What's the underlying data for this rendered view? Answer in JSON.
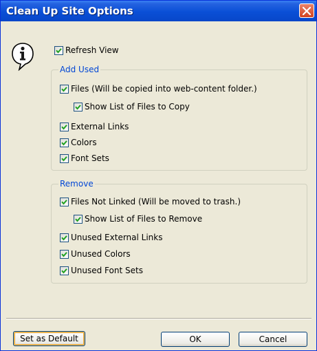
{
  "window": {
    "title": "Clean Up Site Options"
  },
  "options": {
    "refresh_view": {
      "label": "Refresh View",
      "checked": true
    }
  },
  "add_used": {
    "legend": "Add Used",
    "files": {
      "label": "Files (Will be copied into web-content folder.)",
      "checked": true
    },
    "show_files_to_copy": {
      "label": "Show List of Files to Copy",
      "checked": true
    },
    "external_links": {
      "label": "External Links",
      "checked": true
    },
    "colors": {
      "label": "Colors",
      "checked": true
    },
    "font_sets": {
      "label": "Font Sets",
      "checked": true
    }
  },
  "remove": {
    "legend": "Remove",
    "files_not_linked": {
      "label": "Files Not Linked (Will be moved to trash.)",
      "checked": true
    },
    "show_files_to_remove": {
      "label": "Show List of Files to Remove",
      "checked": true
    },
    "unused_external_links": {
      "label": "Unused External Links",
      "checked": true
    },
    "unused_colors": {
      "label": "Unused Colors",
      "checked": true
    },
    "unused_font_sets": {
      "label": "Unused Font Sets",
      "checked": true
    }
  },
  "buttons": {
    "set_default": "Set as Default",
    "ok": "OK",
    "cancel": "Cancel"
  },
  "icons": {
    "info": "info-icon",
    "close": "close-icon",
    "check": "checkmark-icon"
  },
  "colors": {
    "title_bar": "#0a4fd6",
    "close_button": "#d2421f",
    "dialog_bg": "#ece9d8",
    "group_legend": "#0046d5",
    "checkmark": "#21a121"
  }
}
